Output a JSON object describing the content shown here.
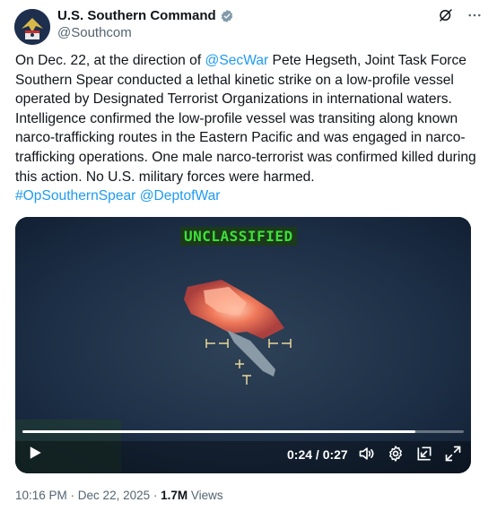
{
  "account": {
    "name": "U.S. Southern Command",
    "handle": "@Southcom"
  },
  "tweet": {
    "t1": "On Dec. 22, at the direction of ",
    "mention1": "@SecWar",
    "t2": " Pete Hegseth, Joint Task Force Southern Spear conducted a lethal kinetic strike on a low-profile vessel operated by Designated Terrorist Organizations in international waters. Intelligence confirmed the low-profile vessel was transiting along known narco-trafficking routes in the Eastern Pacific and was engaged in narco-trafficking operations. One male narco-terrorist was confirmed killed during this action. No U.S. military forces were harmed.",
    "hashtag": "#OpSouthernSpear",
    "mention2": "@DeptofWar"
  },
  "video": {
    "overlay_label": "UNCLASSIFIED",
    "time": "0:24 / 0:27",
    "progress": 0.89
  },
  "meta": {
    "time": "10:16 PM",
    "separator": " · ",
    "date": "Dec 22, 2025",
    "views_count": "1.7M",
    "views_label": " Views"
  },
  "colors": {
    "link": "#1d9bf0",
    "secondary_text": "#536471",
    "overlay_green": "#3ee03a"
  }
}
